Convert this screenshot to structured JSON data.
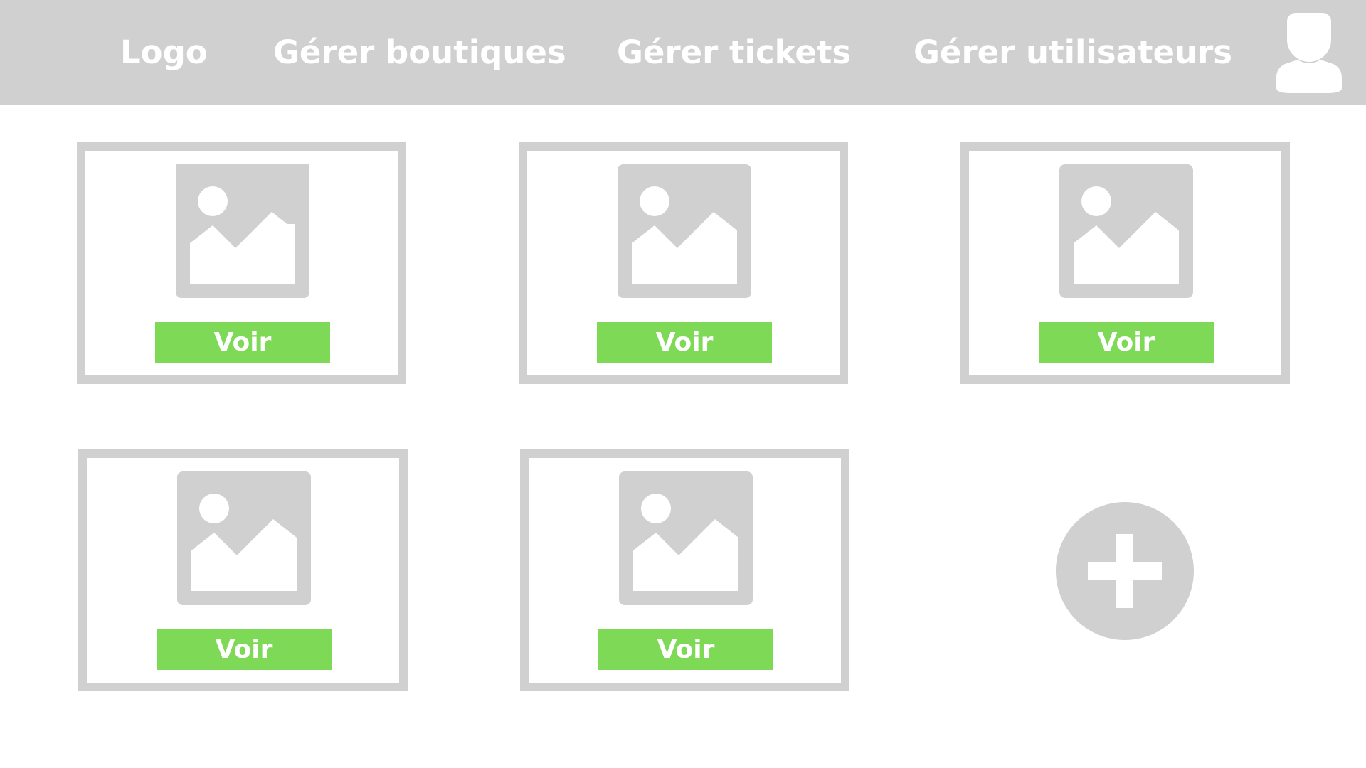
{
  "header": {
    "nav": [
      {
        "label": "Logo"
      },
      {
        "label": "Gérer boutiques"
      },
      {
        "label": "Gérer tickets"
      },
      {
        "label": "Gérer utilisateurs"
      }
    ],
    "user_icon": "user-avatar-icon"
  },
  "cards": [
    {
      "button_label": "Voir",
      "icon": "image-placeholder-icon"
    },
    {
      "button_label": "Voir",
      "icon": "image-placeholder-icon"
    },
    {
      "button_label": "Voir",
      "icon": "image-placeholder-icon"
    },
    {
      "button_label": "Voir",
      "icon": "image-placeholder-icon"
    },
    {
      "button_label": "Voir",
      "icon": "image-placeholder-icon"
    }
  ],
  "add_button": {
    "icon": "plus-icon"
  },
  "colors": {
    "header_bg": "#d0d0d0",
    "card_border": "#d0d0d0",
    "button_bg": "#7ed957",
    "text_light": "#ffffff"
  }
}
